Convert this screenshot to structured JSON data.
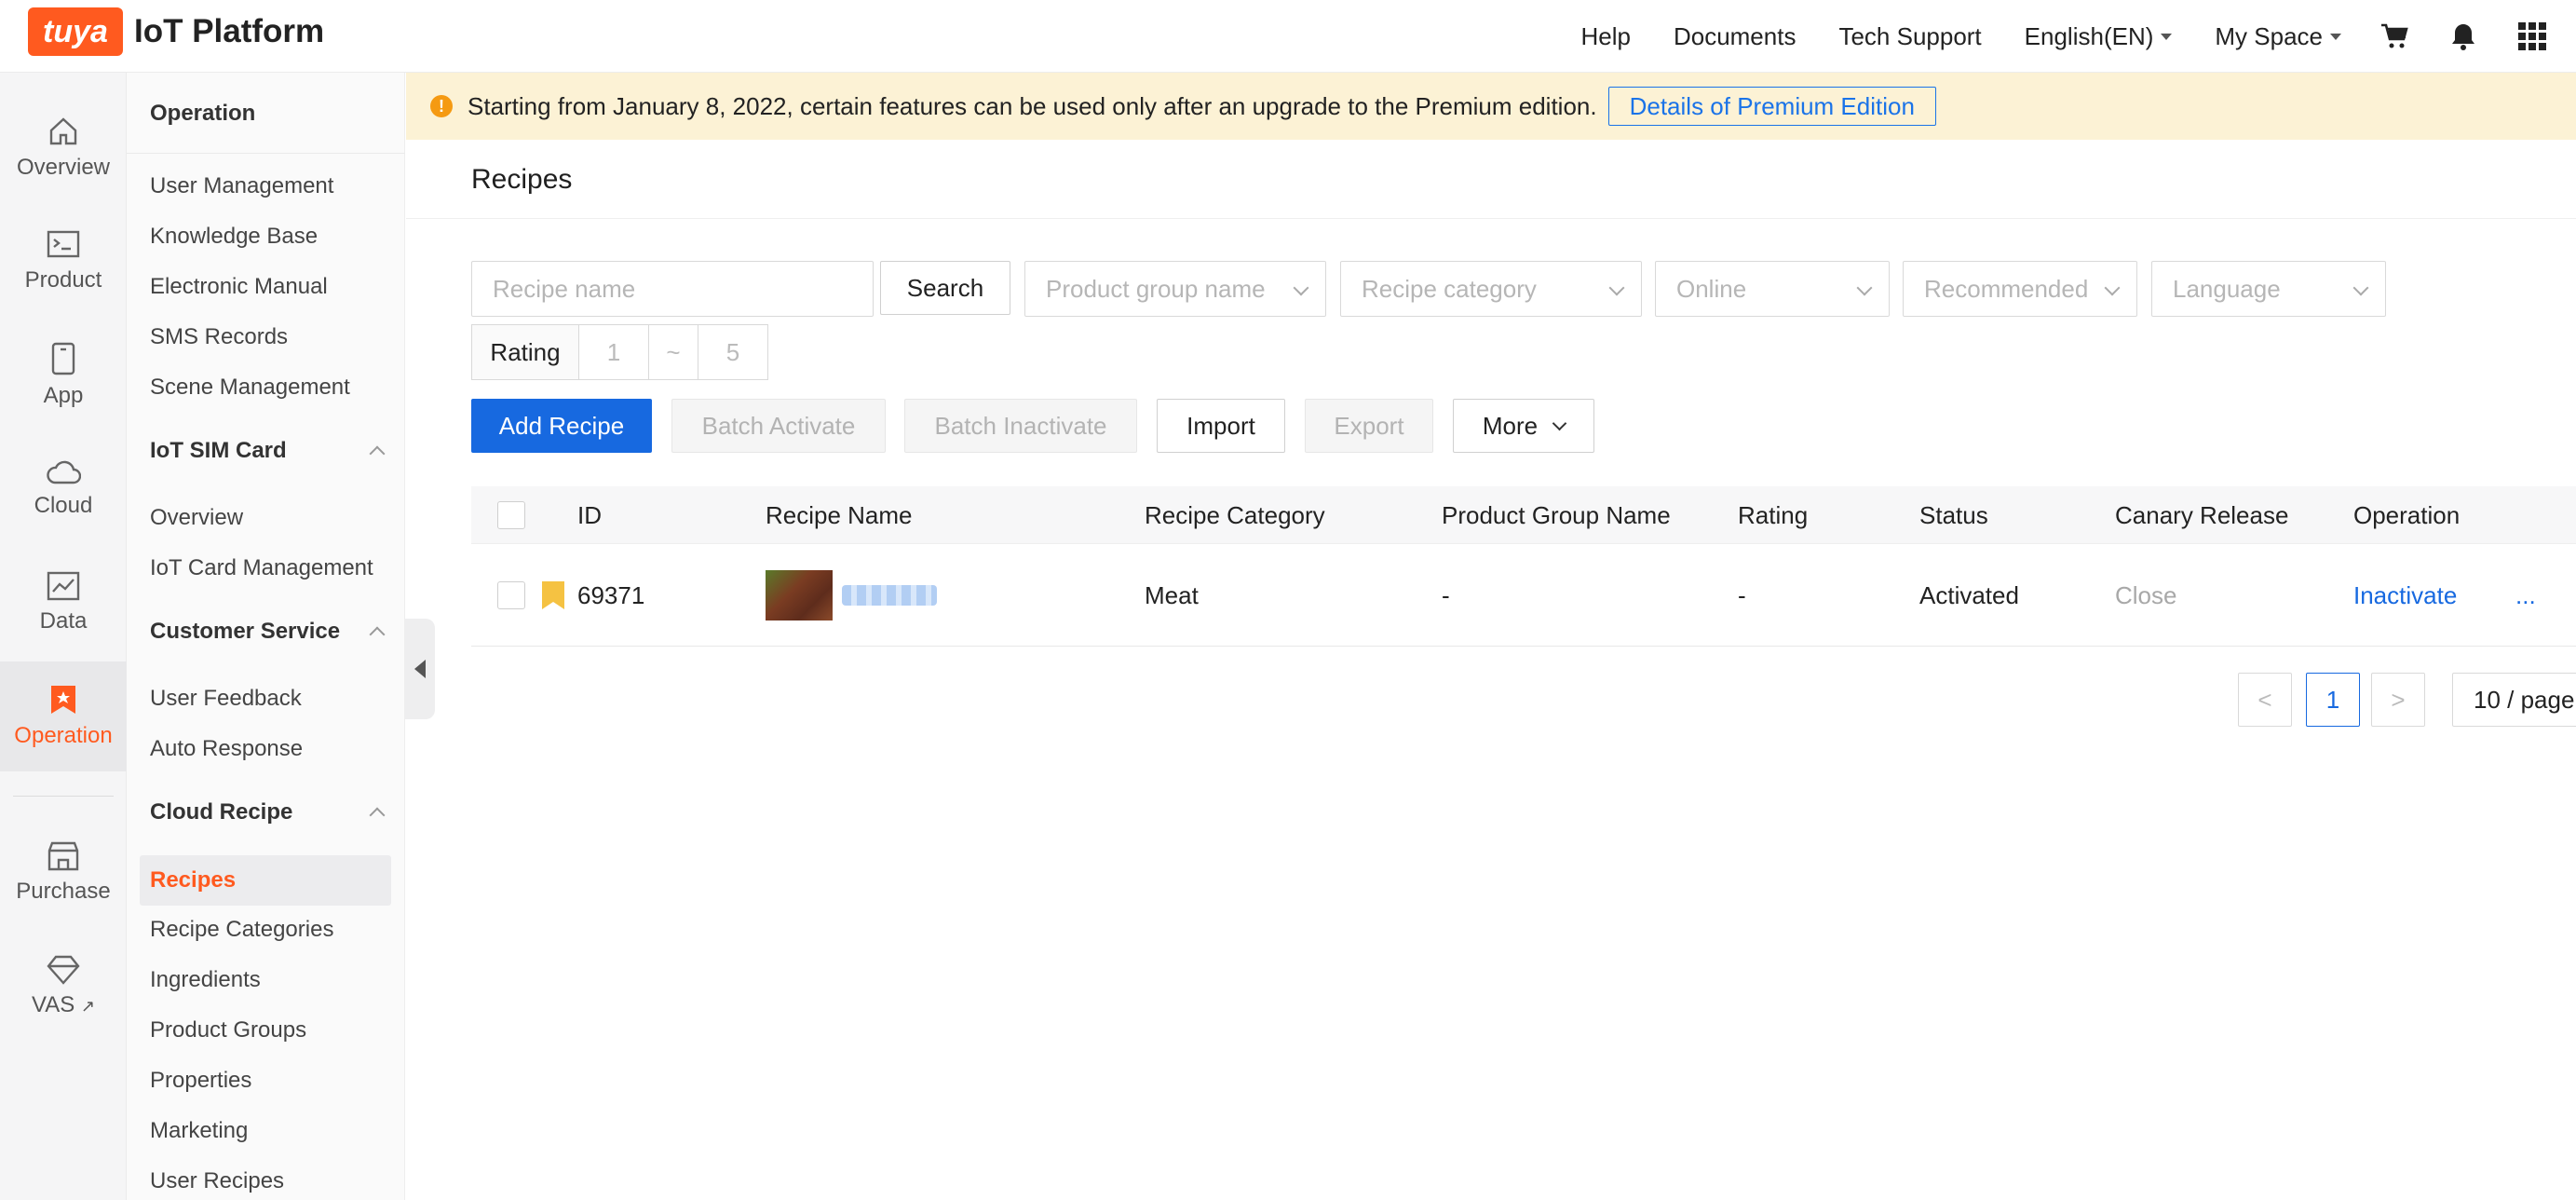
{
  "header": {
    "logo_brand": "tuya",
    "logo_text": "IoT Platform",
    "nav": [
      "Help",
      "Documents",
      "Tech Support"
    ],
    "language": "English(EN)",
    "space": "My Space",
    "icons": [
      "cart-icon",
      "bell-icon",
      "apps-grid-icon"
    ]
  },
  "rail": {
    "items": [
      "Overview",
      "Product",
      "App",
      "Cloud",
      "Data",
      "Operation",
      "Purchase",
      "VAS"
    ],
    "active": "Operation"
  },
  "menu": {
    "section_title": "Operation",
    "operation_items": [
      "User Management",
      "Knowledge Base",
      "Electronic Manual",
      "SMS Records",
      "Scene Management"
    ],
    "groups": {
      "iot_sim": {
        "label": "IoT SIM Card",
        "items": [
          "Overview",
          "IoT Card Management"
        ]
      },
      "customer_service": {
        "label": "Customer Service",
        "items": [
          "User Feedback",
          "Auto Response"
        ]
      },
      "cloud_recipe": {
        "label": "Cloud Recipe",
        "items": [
          "Recipes",
          "Recipe Categories",
          "Ingredients",
          "Product Groups",
          "Properties",
          "Marketing",
          "User Recipes"
        ]
      }
    },
    "active_item": "Recipes"
  },
  "banner": {
    "text": "Starting from January 8, 2022, certain features can be used only after an upgrade to the Premium edition.",
    "button": "Details of Premium Edition"
  },
  "page": {
    "title": "Recipes"
  },
  "filters": {
    "recipe_name_placeholder": "Recipe name",
    "search_label": "Search",
    "product_group_placeholder": "Product group name",
    "recipe_category_placeholder": "Recipe category",
    "online_placeholder": "Online",
    "recommended_placeholder": "Recommended",
    "language_placeholder": "Language",
    "rating_label": "Rating",
    "rating_min": "1",
    "rating_sep": "~",
    "rating_max": "5"
  },
  "actions": {
    "add": "Add Recipe",
    "batch_activate": "Batch Activate",
    "batch_inactivate": "Batch Inactivate",
    "import": "Import",
    "export": "Export",
    "more": "More"
  },
  "table": {
    "columns": [
      "ID",
      "Recipe Name",
      "Recipe Category",
      "Product Group Name",
      "Rating",
      "Status",
      "Canary Release",
      "Operation"
    ],
    "rows": [
      {
        "id": "69371",
        "category": "Meat",
        "product_group": "-",
        "rating": "-",
        "status": "Activated",
        "canary": "Close",
        "operation": "Inactivate",
        "more": "..."
      }
    ]
  },
  "pagination": {
    "current_page": "1",
    "prev": "<",
    "next": ">",
    "page_size": "10 / page"
  },
  "colors": {
    "brand": "#ff5a1f",
    "primary": "#1769e0",
    "banner_bg": "#fcf2d5",
    "warning": "#f59a12"
  }
}
